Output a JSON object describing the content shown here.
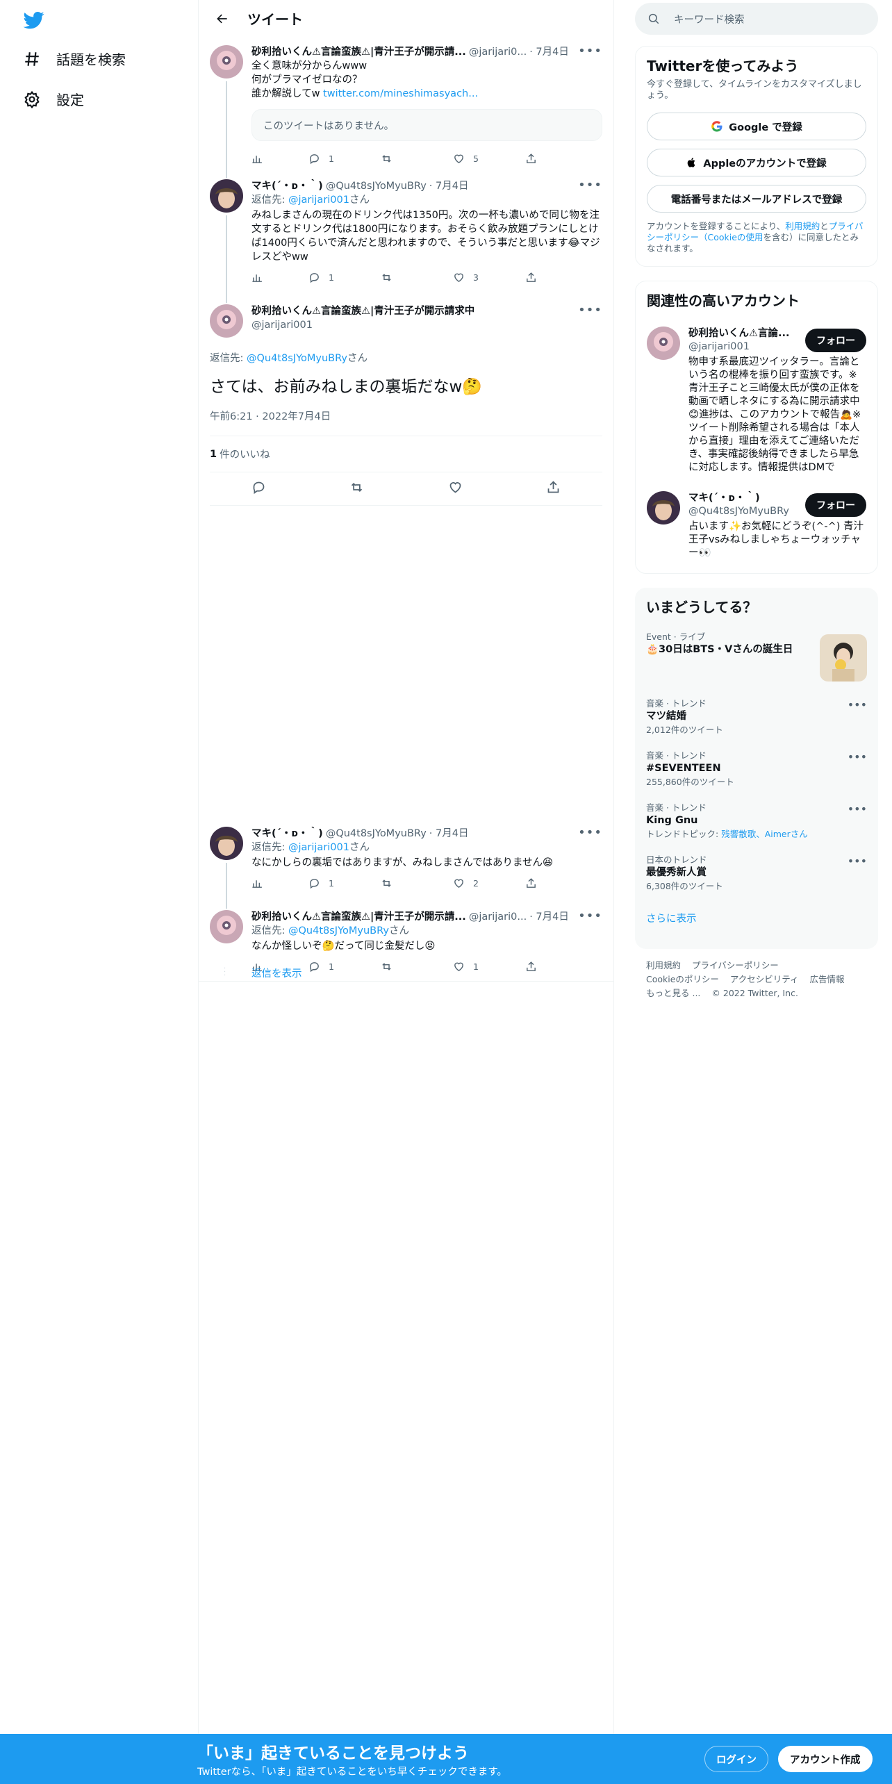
{
  "nav": {
    "explore_label": "話題を検索",
    "settings_label": "設定"
  },
  "header": {
    "title": "ツイート"
  },
  "tweets": [
    {
      "name": "砂利拾いくん⚠言論蛮族⚠|青汁王子が開示請...",
      "handle": "@jarijari0...",
      "date": "· 7月4日",
      "lines": [
        "全く意味が分からんwww",
        "何がプラマイゼロなの？"
      ],
      "link_prefix": "誰か解説してw ",
      "link": "twitter.com/mineshimasyach...",
      "quote_unavailable": "このツイートはありません。",
      "replies": "1",
      "retweets": "",
      "likes": "5"
    },
    {
      "name": "マキ(´・ᴅ・｀)",
      "handle": "@Qu4t8sJYoMyuBRy",
      "date": "· 7月4日",
      "reply_prefix": "返信先: ",
      "reply_to": "@jarijari001",
      "reply_suffix": "さん",
      "body": "みねしまさんの現在のドリンク代は1350円。次の一杯も濃いめで同じ物を注文するとドリンク代は1800円になります。おそらく飲み放題プランにしとけば1400円くらいで済んだと思われますので、そういう事だと思います😂マジレスどやww",
      "replies": "1",
      "retweets": "",
      "likes": "3"
    }
  ],
  "focus": {
    "name": "砂利拾いくん⚠言論蛮族⚠|青汁王子が開示請求中",
    "handle": "@jarijari001",
    "reply_prefix": "返信先: ",
    "reply_to": "@Qu4t8sJYoMyuBRy",
    "reply_suffix": "さん",
    "text": "さては、お前みねしまの裏垢だなw🤔",
    "time": "午前6:21 · 2022年7月4日",
    "likes_count": "1",
    "likes_label": "件のいいね"
  },
  "replies": [
    {
      "name": "マキ(´・ᴅ・｀)",
      "handle": "@Qu4t8sJYoMyuBRy",
      "date": "· 7月4日",
      "reply_prefix": "返信先: ",
      "reply_to": "@jarijari001",
      "reply_suffix": "さん",
      "body": "なにかしらの裏垢ではありますが、みねしまさんではありません😆",
      "replies": "1",
      "retweets": "",
      "likes": "2"
    },
    {
      "name": "砂利拾いくん⚠言論蛮族⚠|青汁王子が開示請...",
      "handle": "@jarijari0...",
      "date": "· 7月4日",
      "reply_prefix": "返信先: ",
      "reply_to": "@Qu4t8sJYoMyuBRy",
      "reply_suffix": "さん",
      "body": "なんか怪しいぞ🤔だって同じ金髪だし😡",
      "replies": "1",
      "retweets": "",
      "likes": "1"
    }
  ],
  "show_replies": "返信を表示",
  "search": {
    "placeholder": "キーワード検索"
  },
  "signup_card": {
    "title": "Twitterを使ってみよう",
    "subtitle": "今すぐ登録して、タイムラインをカスタマイズしましょう。",
    "google": "Google で登録",
    "apple": "Appleのアカウントで登録",
    "phone": "電話番号またはメールアドレスで登録",
    "terms_prefix": "アカウントを登録することにより、",
    "terms_link1": "利用規約",
    "terms_and": "と",
    "terms_link2": "プライバシーポリシー（Cookieの使用",
    "terms_suffix": "を含む）に同意したとみなされます。"
  },
  "related": {
    "title": "関連性の高いアカウント",
    "accounts": [
      {
        "name": "砂利拾いくん⚠言論...",
        "handle": "@jarijari001",
        "bio": "物申す系最底辺ツイッタラー。言論という名の棍棒を振り回す蛮族です。※青汁王子こと三崎優太氏が僕の正体を動画で晒しネタにする為に開示請求中😊進捗は、このアカウントで報告🙇※ツイート削除希望される場合は「本人から直接」理由を添えてご連絡いただき、事実確認後納得できましたら早急に対応します。情報提供はDMで",
        "follow": "フォロー"
      },
      {
        "name": "マキ(´・ᴅ・｀)",
        "handle": "@Qu4t8sJYoMyuBRy",
        "bio": "占います✨お気軽にどうぞ(^-^) 青汁王子vsみねしましゃちょーウォッチャー👀",
        "follow": "フォロー"
      }
    ]
  },
  "trends": {
    "title": "いまどうしてる？",
    "items": [
      {
        "ctx": "Event · ライブ",
        "title": "🎂30日はBTS・Vさんの誕生日",
        "count": ""
      },
      {
        "ctx": "音楽 · トレンド",
        "title": "マツ結婚",
        "count": "2,012件のツイート"
      },
      {
        "ctx": "音楽 · トレンド",
        "title": "#SEVENTEEN",
        "count": "255,860件のツイート"
      },
      {
        "ctx": "音楽 · トレンド",
        "title": "King Gnu",
        "count": "",
        "topics_prefix": "トレンドトピック: ",
        "topics": "残響散歌、Aimerさん"
      },
      {
        "ctx": "日本のトレンド",
        "title": "最優秀新人賞",
        "count": "6,308件のツイート"
      }
    ],
    "show_more": "さらに表示"
  },
  "footer": {
    "links": [
      "利用規約",
      "プライバシーポリシー",
      "Cookieのポリシー",
      "アクセシビリティ",
      "広告情報",
      "もっと見る ..."
    ],
    "copyright": "© 2022 Twitter, Inc."
  },
  "bottom_bar": {
    "headline": "「いま」起きていることを見つけよう",
    "sub": "Twitterなら、「いま」起きていることをいち早くチェックできます。",
    "login": "ログイン",
    "signup": "アカウント作成"
  },
  "colors": {
    "accent": "#1d9bf0",
    "text": "#0f1419",
    "muted": "#536471"
  }
}
